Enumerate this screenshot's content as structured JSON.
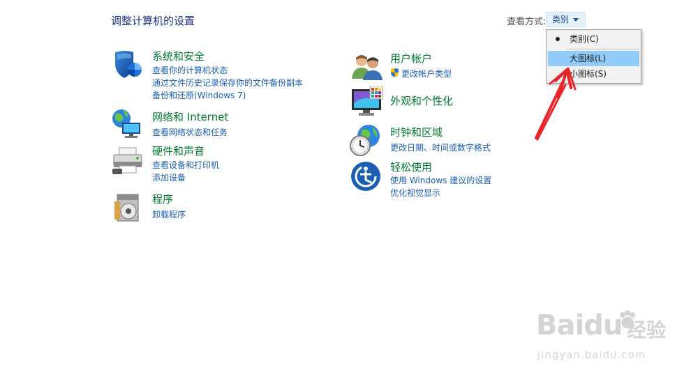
{
  "header": {
    "title": "调整计算机的设置",
    "view_by_label": "查看方式:",
    "view_by_value": "类别"
  },
  "view_menu": {
    "items": [
      {
        "label": "类别(C)",
        "selected": true
      },
      {
        "label": "大图标(L)",
        "highlighted": true
      },
      {
        "label": "小图标(S)"
      }
    ]
  },
  "left_categories": [
    {
      "title": "系统和安全",
      "icon": "shield-icon",
      "links": [
        "查看你的计算机状态",
        "通过文件历史记录保存你的文件备份副本",
        "备份和还原(Windows 7)"
      ]
    },
    {
      "title": "网络和 Internet",
      "icon": "network-globe-icon",
      "links": [
        "查看网络状态和任务"
      ]
    },
    {
      "title": "硬件和声音",
      "icon": "printer-icon",
      "links": [
        "查看设备和打印机",
        "添加设备"
      ]
    },
    {
      "title": "程序",
      "icon": "programs-disc-icon",
      "links": [
        "卸载程序"
      ]
    }
  ],
  "right_categories": [
    {
      "title": "用户帐户",
      "icon": "users-icon",
      "links": [
        "更改帐户类型"
      ]
    },
    {
      "title": "外观和个性化",
      "icon": "monitor-palette-icon",
      "links": []
    },
    {
      "title": "时钟和区域",
      "icon": "clock-globe-icon",
      "links": [
        "更改日期、时间或数字格式"
      ]
    },
    {
      "title": "轻松使用",
      "icon": "ease-of-access-icon",
      "links": [
        "使用 Windows 建议的设置",
        "优化视觉显示"
      ]
    }
  ],
  "watermark": {
    "brand": "Baidu",
    "brand_cn": "经验",
    "url": "jingyan.baidu.com"
  },
  "colors": {
    "title_blue": "#1e3287",
    "category_green": "#007a2f",
    "link_blue": "#1a5fb4",
    "highlight": "#91c9f7",
    "annotation_red": "#e8262a"
  }
}
